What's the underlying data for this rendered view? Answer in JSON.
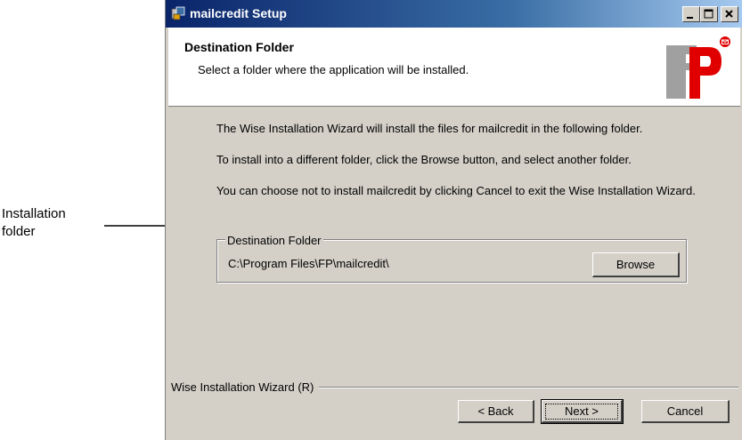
{
  "callout": {
    "label": "Installation\nfolder"
  },
  "window": {
    "title": "mailcredit Setup",
    "buttons": {
      "minimize": "_",
      "maximize": "□",
      "close": "×"
    }
  },
  "header": {
    "title": "Destination Folder",
    "subtitle": "Select a folder where the application will be installed.",
    "logo_text": "FP"
  },
  "body": {
    "paragraph1": "The Wise Installation Wizard will install the files for mailcredit in the following folder.",
    "paragraph2": "To install into a different folder, click the Browse button, and select another folder.",
    "paragraph3": "You can choose not to install mailcredit by clicking Cancel to exit the Wise Installation Wizard."
  },
  "destination": {
    "group_label": "Destination Folder",
    "path": "C:\\Program Files\\FP\\mailcredit\\",
    "browse_label": "Browse"
  },
  "footer": {
    "brand": "Wise Installation Wizard (R)",
    "back_label": "< Back",
    "next_label": "Next >",
    "cancel_label": "Cancel"
  }
}
